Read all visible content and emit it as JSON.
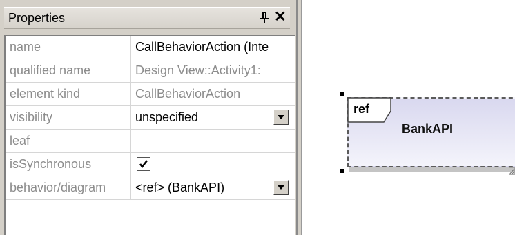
{
  "properties_panel": {
    "title": "Properties",
    "rows": [
      {
        "name": "name",
        "value": "CallBehaviorAction (Inte"
      },
      {
        "name": "qualified name",
        "value": "Design View::Activity1:"
      },
      {
        "name": "element kind",
        "value": "CallBehaviorAction"
      },
      {
        "name": "visibility",
        "value": "unspecified"
      },
      {
        "name": "leaf",
        "value": ""
      },
      {
        "name": "isSynchronous",
        "value": ""
      },
      {
        "name": "behavior/diagram",
        "value": "<ref> (BankAPI)"
      }
    ],
    "leaf_checked": false,
    "isSynchronous_checked": true
  },
  "diagram": {
    "ref_label": "ref",
    "action_name": "BankAPI"
  },
  "icons": [
    "pin-icon",
    "close-icon",
    "dropdown-arrow-icon",
    "checkmark-icon"
  ]
}
